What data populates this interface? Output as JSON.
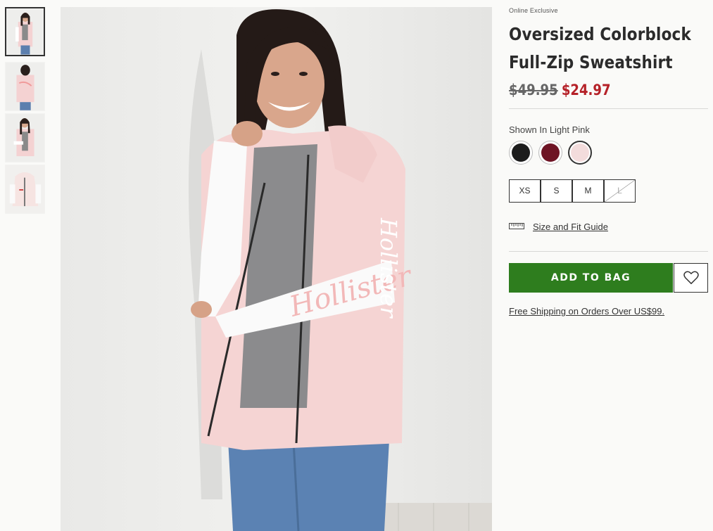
{
  "thumbnails": [
    {
      "alt": "front view",
      "active": true
    },
    {
      "alt": "back view",
      "active": false
    },
    {
      "alt": "side view",
      "active": false
    },
    {
      "alt": "flat lay",
      "active": false
    }
  ],
  "product": {
    "badge": "Online Exclusive",
    "title_line1": "Oversized Colorblock",
    "title_line2": "Full-Zip Sweatshirt",
    "price_original": "$49.95",
    "price_sale": "$24.97",
    "shown_in": "Shown In Light Pink",
    "colors": [
      {
        "name": "Black",
        "hex": "#1c1c1c",
        "selected": false
      },
      {
        "name": "Burgundy",
        "hex": "#6e1424",
        "selected": false
      },
      {
        "name": "Light Pink",
        "hex": "#f3dcdc",
        "selected": true
      }
    ],
    "sizes": [
      {
        "label": "XS",
        "available": true
      },
      {
        "label": "S",
        "available": true
      },
      {
        "label": "M",
        "available": true
      },
      {
        "label": "L",
        "available": false
      }
    ],
    "fit_guide_label": "Size and Fit Guide",
    "add_to_bag_label": "ADD TO BAG",
    "shipping_text": "Free Shipping on Orders Over US$99."
  },
  "colors": {
    "accent_green": "#2e7d1e",
    "sale_red": "#b52128"
  }
}
